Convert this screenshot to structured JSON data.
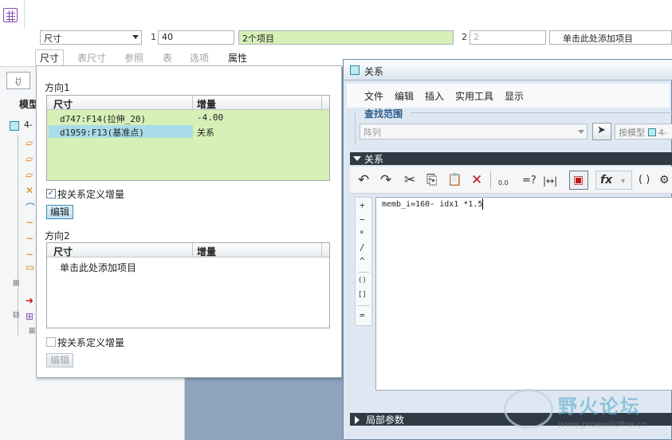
{
  "dashboard": {
    "type_select": "尺寸",
    "dir1_index": "1",
    "dir1_count": "40",
    "items_count": "2个项目",
    "dir2_index": "2",
    "dir2_count": "2",
    "add_item": "单击此处添加项目",
    "tabs": [
      "尺寸",
      "表尺寸",
      "参照",
      "表",
      "选项",
      "属性"
    ]
  },
  "model_tree": {
    "tab_icon": "ꀀ",
    "label": "模型",
    "root": "4-"
  },
  "pattern_panel": {
    "dir1": {
      "title": "方向1",
      "col_dim": "尺寸",
      "col_incr": "增量",
      "rows": [
        {
          "dim": "d747:F14(拉伸_20)",
          "incr": "-4.00"
        },
        {
          "dim": "d1959:F13(基准点)",
          "incr": "关系"
        }
      ],
      "define_by_relation": "按关系定义增量",
      "edit": "编辑"
    },
    "dir2": {
      "title": "方向2",
      "col_dim": "尺寸",
      "col_incr": "增量",
      "placeholder": "单击此处添加项目",
      "define_by_relation": "按关系定义增量",
      "edit": "编辑"
    }
  },
  "relations_dialog": {
    "title": "关系",
    "menu": [
      "文件",
      "编辑",
      "插入",
      "实用工具",
      "显示"
    ],
    "search_scope": "查找范围",
    "scope_value": "阵列",
    "by_model": "按模型",
    "by_model_item": "4-",
    "relations_label": "关系",
    "toolbar": {
      "undo": "↶",
      "redo": "↷",
      "cut": "✂",
      "copy": "⎘",
      "paste": "📋",
      "delete": "✕",
      "value_label": "0.0",
      "eval": "=?",
      "dimension": "|↔|",
      "fx": "fx",
      "brackets": "( )"
    },
    "operators": [
      "+",
      "−",
      "×",
      "/",
      "^",
      "()",
      "[]",
      "="
    ],
    "relation_text": "memb_i=160- idx1 *1.5",
    "local_params": "局部参数"
  },
  "watermark": {
    "main": "野火论坛",
    "sub": "www.proewildfire.cn"
  },
  "colors": {
    "highlight_green": "#d7f0b8",
    "selected_row": "#a8dce8",
    "dialog_header": "#2f3a45",
    "background_blue": "#8fa3bd"
  }
}
